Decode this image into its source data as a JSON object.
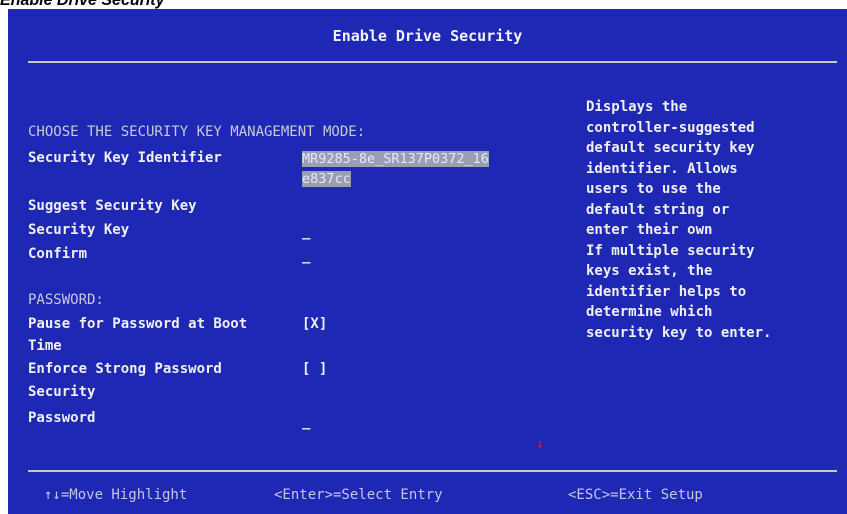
{
  "page": {
    "heading": "Enable Drive Security"
  },
  "screen": {
    "title": "Enable Drive Security",
    "sections": {
      "key_mode": "CHOOSE THE SECURITY KEY MANAGEMENT MODE:",
      "password": "PASSWORD:"
    },
    "fields": {
      "security_key_identifier": {
        "label": "Security Key Identifier",
        "value_line1": "MR9285-8e_SR137P0372_16",
        "value_line2": "e837cc"
      },
      "suggest_security_key": {
        "label": "Suggest Security Key"
      },
      "security_key": {
        "label": "Security Key",
        "value": "_"
      },
      "confirm": {
        "label": "Confirm",
        "value": "_"
      },
      "pause_for_password": {
        "label_line1": "Pause for Password at Boot",
        "label_line2": "Time",
        "value": "[X]"
      },
      "enforce_strong_password": {
        "label_line1": "Enforce Strong Password",
        "label_line2": "Security",
        "value": "[ ]"
      },
      "password": {
        "label": "Password",
        "value": "_"
      }
    },
    "help_text": [
      "Displays the",
      "controller-suggested",
      "default security key",
      "identifier.  Allows",
      "users to use the",
      "default string or",
      "enter their own",
      "If multiple security",
      "keys exist, the",
      "identifier helps to",
      "determine which",
      "security key to enter."
    ],
    "scroll_indicator": "↓",
    "footer": {
      "move": "↑↓=Move Highlight",
      "select": "<Enter>=Select Entry",
      "exit": "<ESC>=Exit Setup"
    }
  },
  "colors": {
    "background": "#1f28b4",
    "text": "#f0f0f0",
    "highlight": "#9a9fb0",
    "scroll_indicator": "#e01010"
  }
}
